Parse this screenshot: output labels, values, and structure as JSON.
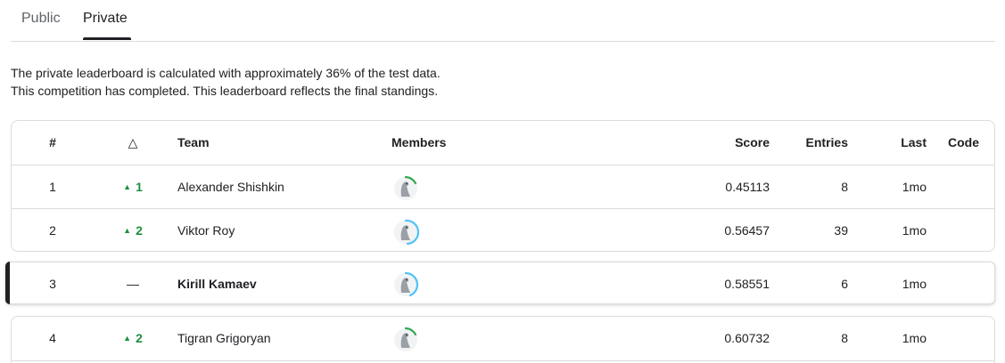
{
  "tabs": [
    {
      "label": "Public",
      "active": false
    },
    {
      "label": "Private",
      "active": true
    }
  ],
  "info": {
    "line1": "The private leaderboard is calculated with approximately 36% of the test data.",
    "line2": "This competition has completed. This leaderboard reflects the final standings."
  },
  "columns": {
    "rank": "#",
    "delta": "△",
    "team": "Team",
    "members": "Members",
    "score": "Score",
    "entries": "Entries",
    "last": "Last",
    "code": "Code"
  },
  "rows": [
    {
      "rank": "1",
      "delta": "1",
      "delta_dir": "up",
      "team": "Alexander Shishkin",
      "members_icon": "user-avatar-icon",
      "score": "0.45113",
      "entries": "8",
      "last": "1mo"
    },
    {
      "rank": "2",
      "delta": "2",
      "delta_dir": "up",
      "team": "Viktor Roy",
      "members_icon": "user-avatar-icon",
      "score": "0.56457",
      "entries": "39",
      "last": "1mo"
    },
    {
      "rank": "3",
      "delta": "—",
      "delta_dir": "none",
      "team": "Kirill Kamaev",
      "members_icon": "user-avatar-icon",
      "score": "0.58551",
      "entries": "6",
      "last": "1mo",
      "highlighted": true
    },
    {
      "rank": "4",
      "delta": "2",
      "delta_dir": "up",
      "team": "Tigran Grigoryan",
      "members_icon": "user-avatar-icon",
      "score": "0.60732",
      "entries": "8",
      "last": "1mo"
    }
  ],
  "colors": {
    "up": "#1e8e3e",
    "ring_green": "#34a853",
    "ring_blue": "#4fc3f7"
  }
}
